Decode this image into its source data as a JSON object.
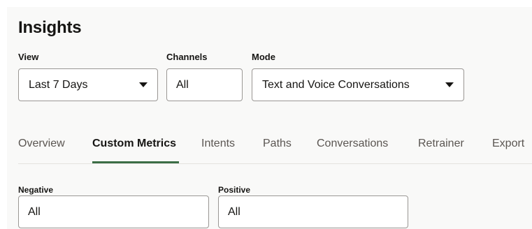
{
  "page": {
    "title": "Insights"
  },
  "filters": {
    "view": {
      "label": "View",
      "value": "Last 7 Days"
    },
    "channels": {
      "label": "Channels",
      "value": "All"
    },
    "mode": {
      "label": "Mode",
      "value": "Text and Voice Conversations"
    }
  },
  "tabs": [
    {
      "label": "Overview",
      "active": false
    },
    {
      "label": "Custom Metrics",
      "active": true
    },
    {
      "label": "Intents",
      "active": false
    },
    {
      "label": "Paths",
      "active": false
    },
    {
      "label": "Conversations",
      "active": false
    },
    {
      "label": "Retrainer",
      "active": false
    },
    {
      "label": "Export",
      "active": false
    }
  ],
  "metrics_filters": {
    "negative": {
      "label": "Negative",
      "value": "All"
    },
    "positive": {
      "label": "Positive",
      "value": "All"
    }
  },
  "colors": {
    "background": "#f9f9f8",
    "active_tab_indicator": "#3b6e46",
    "text": "#161513",
    "muted_text": "#5b5652",
    "field_border": "#9a9794"
  },
  "icons": [
    "caret-down-icon"
  ]
}
